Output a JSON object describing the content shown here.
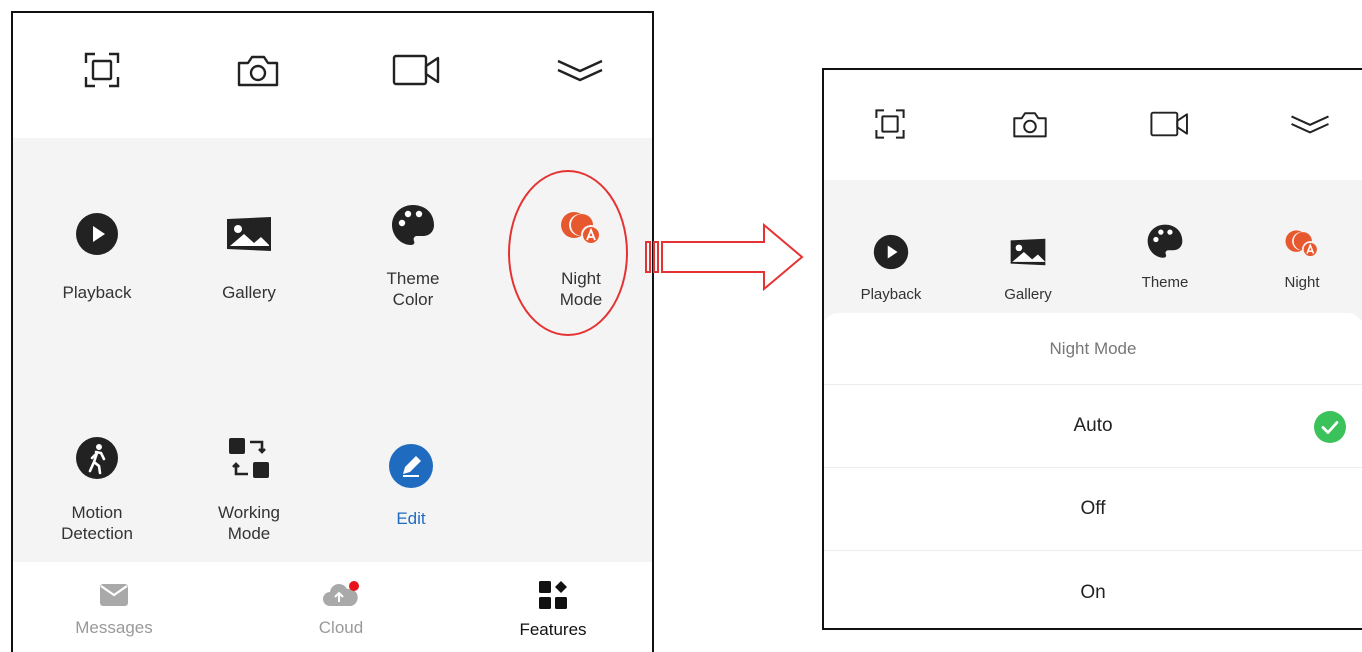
{
  "toolbar": {
    "icons": [
      "screen-fit-icon",
      "camera-icon",
      "video-record-icon",
      "collapse-chevron-icon"
    ]
  },
  "features": {
    "playback": "Playback",
    "gallery": "Gallery",
    "theme_color": "Theme\nColor",
    "night_mode": "Night\nMode",
    "motion_detection": "Motion\nDetection",
    "working_mode": "Working\nMode",
    "edit": "Edit"
  },
  "right_features": {
    "playback": "Playback",
    "gallery": "Gallery",
    "theme": "Theme",
    "night": "Night"
  },
  "bottom_nav": {
    "messages": "Messages",
    "cloud": "Cloud",
    "features": "Features"
  },
  "sheet": {
    "title": "Night Mode",
    "options": [
      "Auto",
      "Off",
      "On"
    ],
    "selected": "Auto"
  },
  "colors": {
    "accent_blue": "#1f6bbf",
    "night_orange": "#e8582e",
    "check_green": "#3cc25a",
    "highlight_red": "#e53333",
    "badge_red": "#e8121a",
    "grid_bg": "#f4f4f4"
  }
}
